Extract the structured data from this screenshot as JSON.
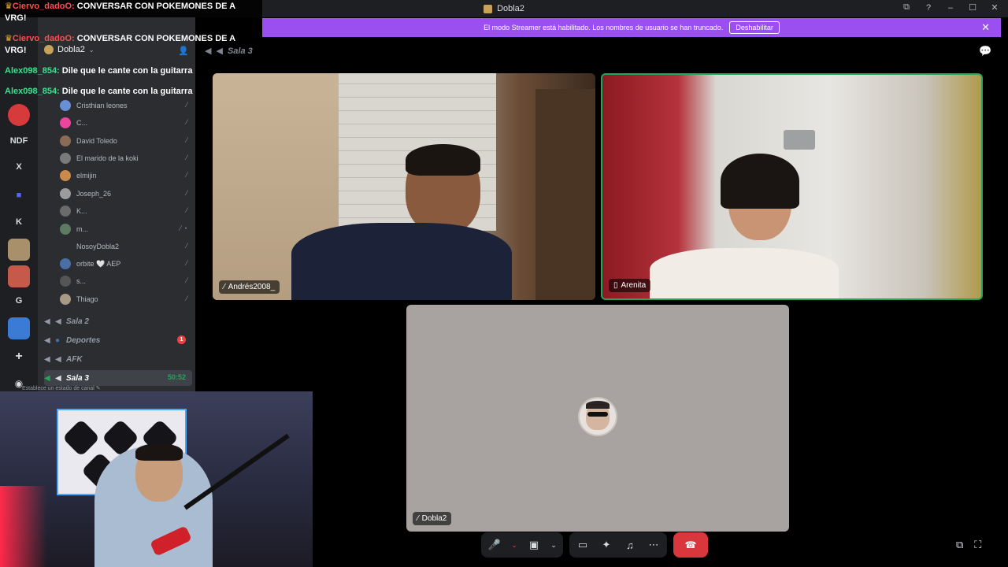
{
  "window": {
    "title": "Dobla2",
    "controls": [
      "⧉",
      "?",
      "–",
      "☐",
      "✕"
    ]
  },
  "banner": {
    "text": "El modo Streamer está habilitado. Los nombres de usuario se han truncado.",
    "button": "Deshabilitar",
    "close": "✕"
  },
  "rail": {
    "items": [
      "NDF",
      "X",
      "K",
      "G"
    ]
  },
  "server": {
    "name": "Dobla2",
    "chevron": "⌄"
  },
  "members": [
    {
      "name": "Cristhian leones",
      "color": "#6a8fd6"
    },
    {
      "name": "C...",
      "color": "#eb459e"
    },
    {
      "name": "David Toledo",
      "color": "#8a6b54"
    },
    {
      "name": "El marido de la koki",
      "color": "#7a7a7a"
    },
    {
      "name": "elmijin",
      "color": "#c98a4b"
    },
    {
      "name": "Joseph_26",
      "color": "#9c9c9c"
    },
    {
      "name": "K...",
      "color": "#6b6b6b"
    },
    {
      "name": "m...",
      "color": "#5e7a63"
    },
    {
      "name": "NosoyDobla2",
      "color": "#2b2d31"
    },
    {
      "name": "orbite 🤍 AEP",
      "color": "#4a6fa5"
    },
    {
      "name": "s...",
      "color": "#555"
    },
    {
      "name": "Thiago",
      "color": "#a89a86"
    }
  ],
  "voice_channels": [
    {
      "name": "Sala 2"
    },
    {
      "name": "Deportes",
      "badge": "1"
    },
    {
      "name": "AFK"
    },
    {
      "name": "Sala 3",
      "timer": "50:52"
    }
  ],
  "status_hint": "Establece un estado de canal ✎",
  "chat": [
    {
      "user": "Ciervo_dadoO:",
      "message": "CONVERSAR CON POKEMONES DE A"
    },
    {
      "cont": "VRG!"
    },
    {
      "user": "Ciervo_dadoO:",
      "message": "CONVERSAR CON POKEMONES DE A"
    },
    {
      "cont": "VRG!"
    },
    {
      "user": "Alex098_854:",
      "message": "Dile que le cante con la guitarra"
    },
    {
      "user": "Alex098_854:",
      "message": "Dile que le cante con la guitarra"
    }
  ],
  "stage": {
    "channel": "Sala 3"
  },
  "tiles": {
    "andres": "Andrés2008_",
    "arenita": "Arenita",
    "dobla": "Dobla2"
  },
  "colors": {
    "banner": "#9b4ff0",
    "speaking_border": "#23a55a",
    "hangup": "#da373c"
  },
  "icons": {
    "mic_muted": "mic-muted-icon",
    "camera_off": "camera-off-icon",
    "screen_share": "screen-share-icon",
    "activities": "activities-icon",
    "soundboard": "soundboard-icon",
    "more": "more-icon",
    "hangup": "phone-hangup-icon"
  }
}
